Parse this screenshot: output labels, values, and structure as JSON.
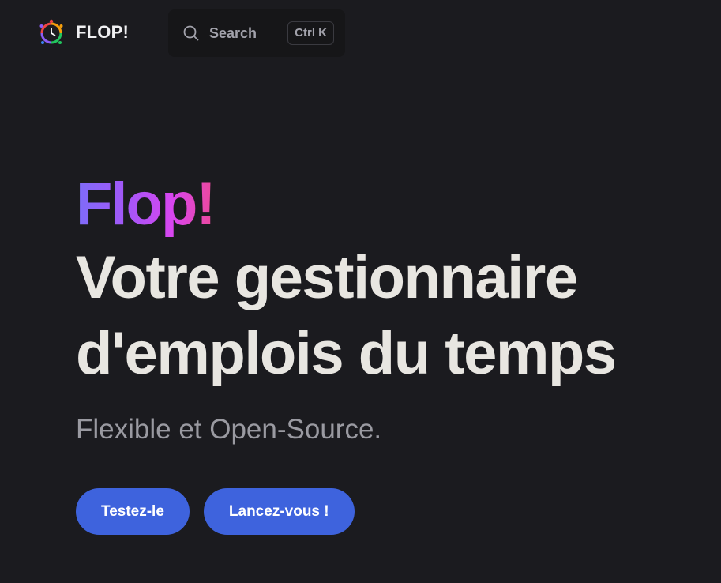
{
  "nav": {
    "brand_title": "FLOP!",
    "brand_icon": "flop-logo-icon",
    "search": {
      "placeholder": "Search",
      "shortcut": "Ctrl K",
      "icon": "search-icon"
    }
  },
  "hero": {
    "name": "Flop!",
    "text_line_1": "Votre gestionnaire",
    "text_line_2": "d'emplois du temps",
    "tagline": "Flexible et Open-Source."
  },
  "actions": {
    "primary_label": "Testez-le",
    "secondary_label": "Lancez-vous !"
  },
  "colors": {
    "background": "#1b1b1f",
    "brand_button": "#3e63dd",
    "gradient_start": "#7d6cf8",
    "gradient_end": "#ec4899"
  }
}
